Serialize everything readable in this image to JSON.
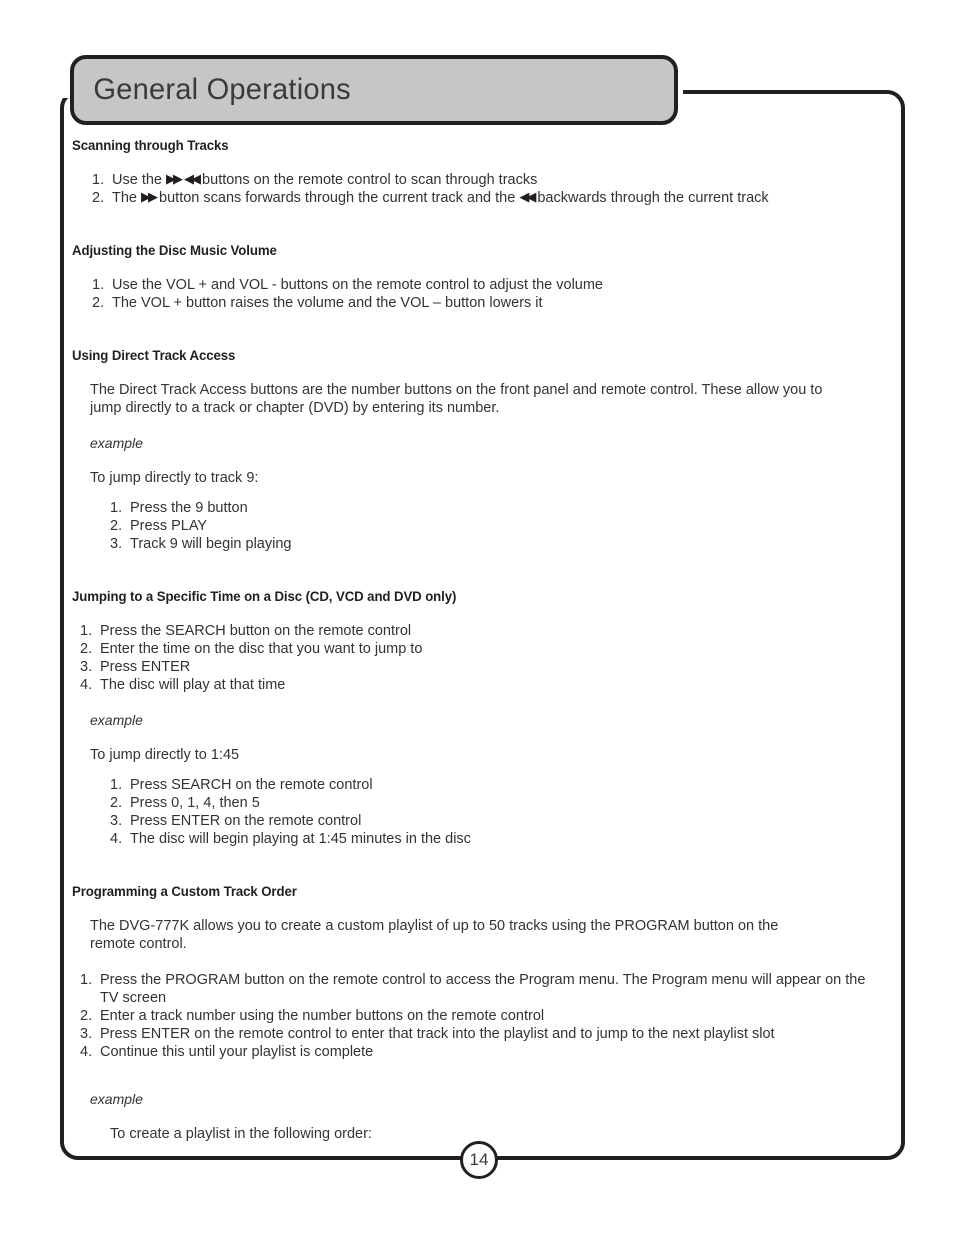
{
  "page": {
    "title": "General Operations",
    "number": "14",
    "colors": {
      "title_tab_background": "#c6c6c6",
      "frame_border": "#231f20",
      "body_text": "#333335",
      "page_background": "#ffffff"
    }
  },
  "icons": {
    "fast_forward": "▶▶",
    "rewind": "◀◀"
  },
  "sections": [
    {
      "id": "scanning-through-tracks",
      "heading": "Scanning through Tracks",
      "steps": [
        {
          "num": "1.",
          "pre": "Use the ",
          "glyph1": "▶▶",
          "mid": " ",
          "glyph2": "◀◀",
          "post": " buttons on the remote control to scan through tracks"
        },
        {
          "num": "2.",
          "pre": "The ",
          "glyph1": "▶▶",
          "mid": " button scans forwards through the current track and the ",
          "glyph2": "◀◀",
          "post": " backwards through the current track"
        }
      ]
    },
    {
      "id": "adjusting-the-disc-music-volume",
      "heading": "Adjusting the Disc Music Volume",
      "steps": [
        {
          "num": "1.",
          "text": "Use the VOL + and VOL - buttons on the remote control to adjust the volume"
        },
        {
          "num": "2.",
          "text": "The VOL + button raises the volume and the VOL – button lowers it"
        }
      ]
    },
    {
      "id": "using-direct-track-access",
      "heading": "Using Direct Track Access",
      "paragraph": "The Direct Track Access buttons are the number buttons on the front panel and remote control.  These allow you to jump directly to a track or chapter (DVD) by entering its number.",
      "example_label": "example",
      "example_intro": "To jump directly to track 9:",
      "steps": [
        {
          "num": "1.",
          "text": "Press the 9 button"
        },
        {
          "num": "2.",
          "text": "Press PLAY"
        },
        {
          "num": "3.",
          "text": "Track 9 will begin playing"
        }
      ]
    },
    {
      "id": "jumping-to-a-specific-time",
      "heading": "Jumping to a Specific Time on a Disc (CD, VCD and DVD only)",
      "steps": [
        {
          "num": "1.",
          "text": "Press the SEARCH button on the remote control"
        },
        {
          "num": "2.",
          "text": "Enter the time on the disc that you want to jump to"
        },
        {
          "num": "3.",
          "text": "Press ENTER"
        },
        {
          "num": "4.",
          "text": "The disc will play at that time"
        }
      ],
      "example_label": "example",
      "example_intro": "To jump directly to 1:45",
      "example_steps": [
        {
          "num": "1.",
          "text": "Press SEARCH on the remote control"
        },
        {
          "num": "2.",
          "text": "Press 0, 1, 4, then 5"
        },
        {
          "num": "3.",
          "text": "Press ENTER on the remote control"
        },
        {
          "num": "4.",
          "text": "The disc will begin playing at 1:45 minutes in the disc"
        }
      ]
    },
    {
      "id": "programming-a-custom-track-order",
      "heading": "Programming a Custom Track Order",
      "paragraph": "The DVG-777K allows you to create a custom playlist of up to 50 tracks using the PROGRAM button on the remote control.",
      "steps": [
        {
          "num": "1.",
          "text": "Press the PROGRAM button on the remote control to access the Program menu.  The Program menu will appear on the TV screen"
        },
        {
          "num": "2.",
          "text": "Enter a track number using the number buttons on the remote control"
        },
        {
          "num": "3.",
          "text": "Press ENTER on the remote control to enter that track into the playlist and to jump to the next playlist slot"
        },
        {
          "num": "4.",
          "text": "Continue this until your playlist is complete"
        }
      ],
      "example_label": "example",
      "example_intro": "To create a playlist in the following order:"
    }
  ]
}
